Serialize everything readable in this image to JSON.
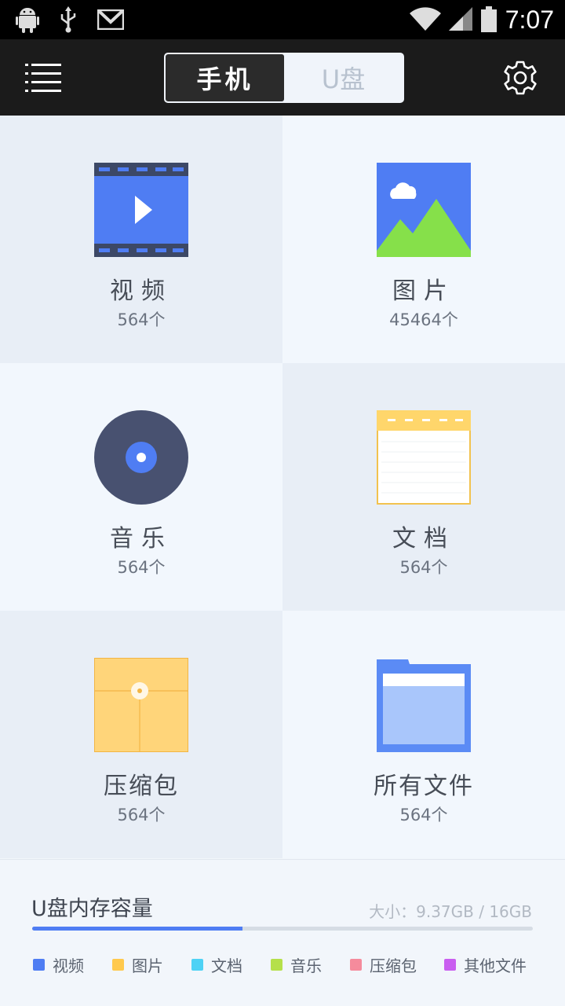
{
  "status_bar": {
    "time": "7:07",
    "icons": [
      "android-icon",
      "usb-icon",
      "gmail-icon",
      "wifi-icon",
      "signal-icon",
      "battery-icon"
    ]
  },
  "toolbar": {
    "tabs": [
      {
        "label": "手机",
        "active": true
      },
      {
        "label": "U盘",
        "active": false
      }
    ]
  },
  "categories": [
    {
      "label": "视频",
      "count": "564个"
    },
    {
      "label": "图片",
      "count": "45464个"
    },
    {
      "label": "音乐",
      "count": "564个"
    },
    {
      "label": "文档",
      "count": "564个"
    },
    {
      "label": "压缩包",
      "count": "564个"
    },
    {
      "label": "所有文件",
      "count": "564个"
    }
  ],
  "storage": {
    "title": "U盘内存容量",
    "size": "大小：9.37GB / 16GB",
    "used_fraction": 0.42,
    "legend": [
      {
        "label": "视频",
        "color": "#4f7df3"
      },
      {
        "label": "图片",
        "color": "#ffc94d"
      },
      {
        "label": "文档",
        "color": "#4ed2f5"
      },
      {
        "label": "音乐",
        "color": "#b5e04a"
      },
      {
        "label": "压缩包",
        "color": "#f58b9c"
      },
      {
        "label": "其他文件",
        "color": "#c95ef0"
      }
    ]
  },
  "colors": {
    "accent": "#4f7df3",
    "toolbar_bg": "#1b1b1b"
  }
}
